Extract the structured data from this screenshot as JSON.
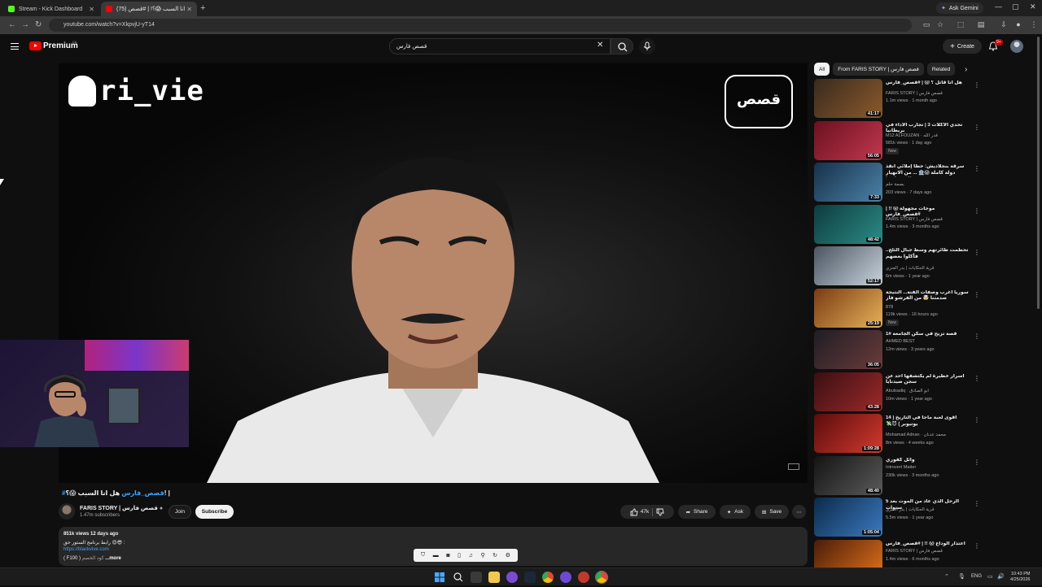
{
  "browser": {
    "tabs": [
      {
        "label": "Stream - Kick Dashboard",
        "favicon_color": "#53fc18"
      },
      {
        "label": "(75) هل انا السبب 😱؟! | #قصص...",
        "favicon_color": "#ff0000"
      }
    ],
    "new_tab_symbol": "+",
    "gemini_label": "Ask Gemini",
    "url": "youtube.com/watch?v=XkpvjU-yT14"
  },
  "youtube_header": {
    "brand": "Premium",
    "region": "CA",
    "search_value": "قصص فارس",
    "create_label": "Create",
    "notification_badge": "9+"
  },
  "video": {
    "overlay_handle": "ri_vie",
    "overlay_logo_text": "قصص"
  },
  "watch": {
    "title_hashtag": "#قصص_فارس",
    "title_text": "هل انا السبب 😱؟! |",
    "channel_name": "FARIS STORY | قصص فارس",
    "subscribers": "1.47m subscribers",
    "join_label": "Join",
    "subscribe_label": "Subscribe",
    "likes": "47k",
    "share_label": "Share",
    "ask_label": "Ask",
    "save_label": "Save"
  },
  "description": {
    "meta": "851k views  12 days ago",
    "line1": "رابط برنامج الستور حق 😍😎 :",
    "link": "https://blackvive.com",
    "line3_code": "( F100 ) ",
    "line3_text": "كود الخصم ",
    "more_label": "...more"
  },
  "sidebar": {
    "chips": [
      "All",
      "From FARIS STORY | قصص فارس",
      "Related"
    ],
    "recommendations": [
      {
        "title": "هل انا قاتل ؟ 😱 | #قصص_فارس",
        "channel": "FARIS STORY | قصص فارس",
        "meta": "1.1m views · 1 month ago",
        "duration": "41:17",
        "new": false,
        "colors": [
          "#3a2a1e",
          "#8a5a2c"
        ]
      },
      {
        "title": "تحدي الأكلات 3 | تجارب الأداء في بريطانيا",
        "channel": "M12 ALFOUZAN · قدر الله",
        "meta": "581k views · 1 day ago",
        "duration": "56:05",
        "new": true,
        "colors": [
          "#6b1020",
          "#c2384f"
        ]
      },
      {
        "title": "سرقة بنجلاديش: خطأ إملائي أنقذ دولة كاملة 😱🏦 ... من الانهيار الاقتصادي!",
        "channel": "بصمة حلم",
        "meta": "203 views · 7 days ago",
        "duration": "7:33",
        "new": false,
        "colors": [
          "#16314a",
          "#4c82a8"
        ]
      },
      {
        "title": "موجات مجهولة 😱 !! | #قصص_فارس",
        "channel": "FARIS STORY | قصص فارس",
        "meta": "1.4m views · 3 months ago",
        "duration": "48:42",
        "new": false,
        "colors": [
          "#0e3b3f",
          "#2b8c86"
        ]
      },
      {
        "title": "تحطمت طائرتهم وسط جبال الثلج.. فأكلوا بعضهم",
        "channel": "قرية الحكايات | بدر العنزي",
        "meta": "6m views · 1 year ago",
        "duration": "52:17",
        "new": false,
        "colors": [
          "#4a5561",
          "#c9d3dc"
        ]
      },
      {
        "title": "سوريا أغرب وصفات الفتة... النتيجة صدمتنا 🤯 من الفرشو فاز",
        "channel": "878",
        "meta": "119k views · 16 hours ago",
        "duration": "25:19",
        "new": true,
        "colors": [
          "#7a3b12",
          "#e6b15a"
        ]
      },
      {
        "title": "قصة تزيح في سكن الجامعة #1",
        "channel": "AHMED BEST",
        "meta": "12m views · 3 years ago",
        "duration": "36:05",
        "new": false,
        "colors": [
          "#1e1e24",
          "#6b3b3b"
        ]
      },
      {
        "title": "اسرار خطيرة لم يكتشفها احد عن سجن صيدنايا",
        "channel": "Abulsadiq · ابو الصادق",
        "meta": "10m views · 1 year ago",
        "duration": "43:28",
        "new": false,
        "colors": [
          "#3b0f12",
          "#9b2a2a"
        ]
      },
      {
        "title": "أقوى لعبة ماجا في التاريخ ( 14 يوتيوبر ) 😈💸",
        "channel": "Mohamad Adnan · محمد عدنان",
        "meta": "8m views · 4 weeks ago",
        "duration": "1:09:28",
        "new": false,
        "colors": [
          "#5a0c0c",
          "#d23a2e"
        ]
      },
      {
        "title": "وائل كفوري",
        "channel": "Introvert Matter",
        "meta": "230k views · 3 months ago",
        "duration": "48:40",
        "new": false,
        "colors": [
          "#141414",
          "#5a5a5a"
        ]
      },
      {
        "title": "الرجل الذي عاد من الموت بعد 5 سنوات",
        "channel": "قرية الحكايات | بدر العنزي",
        "meta": "5.5m views · 1 year ago",
        "duration": "1:05:04",
        "new": false,
        "colors": [
          "#0c2a4a",
          "#3b7ac0"
        ]
      },
      {
        "title": "اعتذار الوداع 😱 !! | #قصص_فارس",
        "channel": "FARIS STORY | قصص فارس",
        "meta": "1.4m views · 6 months ago",
        "duration": "",
        "new": false,
        "colors": [
          "#4a1c08",
          "#d26a1a"
        ]
      }
    ]
  },
  "taskbar": {
    "lang": "ENG",
    "time": "10:43 PM",
    "date": "4/25/2026"
  }
}
